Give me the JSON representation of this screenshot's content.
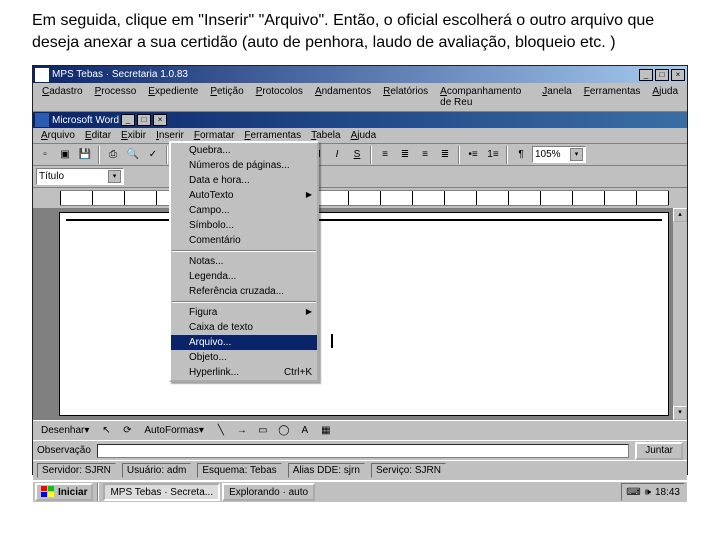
{
  "instruction": "Em seguida, clique em \"Inserir\" \"Arquivo\". Então, o oficial escolherá o outro arquivo que deseja anexar a sua certidão (auto de penhora, laudo de avaliação, bloqueio etc. )",
  "outer_window": {
    "title": "MPS Tebas · Secretaria  1.0.83",
    "menus": [
      "Cadastro",
      "Processo",
      "Expediente",
      "Petição",
      "Protocolos",
      "Andamentos",
      "Relatórios",
      "Acompanhamento de Reu",
      "Janela",
      "Ferramentas",
      "Ajuda"
    ]
  },
  "word_window": {
    "title": "Microsoft Word",
    "menus": [
      "Arquivo",
      "Editar",
      "Exibir",
      "Inserir",
      "Formatar",
      "Ferramentas",
      "Tabela",
      "Ajuda"
    ],
    "style_combo": "Título",
    "zoom": "105%"
  },
  "inserir_menu": [
    {
      "label": "Quebra..."
    },
    {
      "label": "Números de páginas..."
    },
    {
      "label": "Data e hora..."
    },
    {
      "label": "AutoTexto",
      "sub": true
    },
    {
      "label": "Campo..."
    },
    {
      "label": "Símbolo..."
    },
    {
      "label": "Comentário"
    },
    {
      "divider": true
    },
    {
      "label": "Notas..."
    },
    {
      "label": "Legenda..."
    },
    {
      "label": "Referência cruzada..."
    },
    {
      "divider": true
    },
    {
      "label": "Figura",
      "sub": true
    },
    {
      "label": "Caixa de texto"
    },
    {
      "label": "Arquivo...",
      "highlight": true
    },
    {
      "label": "Objeto..."
    },
    {
      "label": "Hyperlink...",
      "shortcut": "Ctrl+K"
    }
  ],
  "draw_toolbar": {
    "desenhar": "Desenhar",
    "autoformas": "AutoFormas"
  },
  "obs_label": "Observação",
  "juntar_btn": "Juntar",
  "statusbar": {
    "servidor": "Servidor: SJRN",
    "usuario": "Usuário: adm",
    "esquema": "Esquema: Tebas",
    "alias": "Alias DDE: sjrn",
    "servico": "Serviço: SJRN"
  },
  "taskbar": {
    "start": "Iniciar",
    "apps": [
      {
        "label": "MPS Tebas · Secreta...",
        "active": true
      },
      {
        "label": "Explorando · auto",
        "active": false
      }
    ],
    "clock": "18:43"
  }
}
